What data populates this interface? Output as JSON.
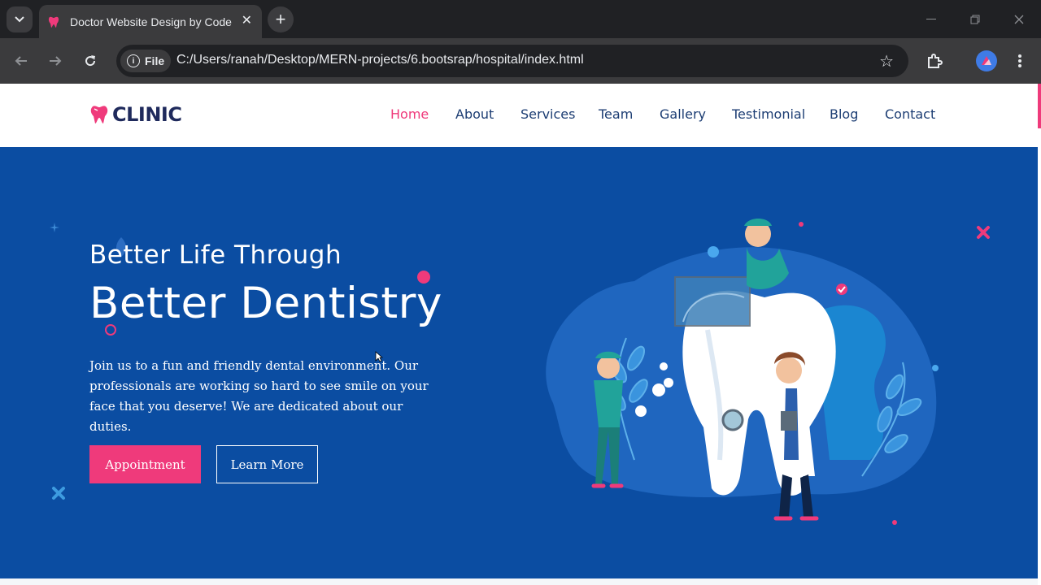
{
  "browser": {
    "tab_title": "Doctor Website Design by Code",
    "tab_close": "✕",
    "new_tab": "+",
    "site_chip_label": "File",
    "url": "C:/Users/ranah/Desktop/MERN-projects/6.bootsrap/hospital/index.html"
  },
  "site": {
    "logo_text": "CLINIC",
    "nav": [
      "Home",
      "About",
      "Services",
      "Team",
      "Gallery",
      "Testimonial",
      "Blog",
      "Contact"
    ],
    "active_nav": "Home"
  },
  "hero": {
    "subtitle": "Better Life Through",
    "title": "Better Dentistry",
    "text": "Join us to a fun and friendly dental environment. Our professionals are working so hard to see smile on your face that you deserve! We are dedicated about our duties.",
    "primary_button": "Appointment",
    "secondary_button": "Learn More"
  },
  "colors": {
    "accent": "#ef3a7b",
    "hero_bg": "#0b4da2",
    "nav_text": "#1c3d73",
    "logo_text": "#1f2a5c"
  }
}
